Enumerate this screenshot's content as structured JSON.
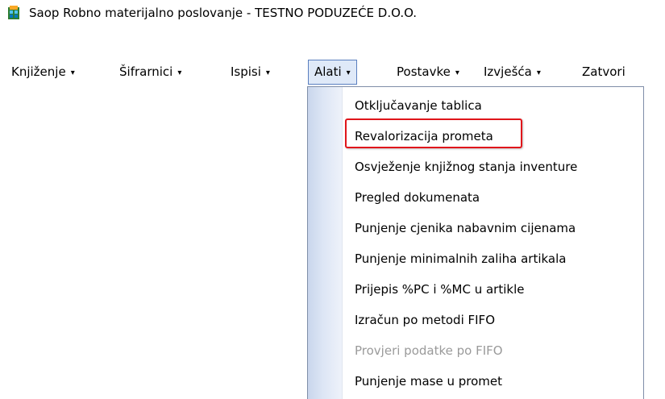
{
  "window": {
    "title": "Saop  Robno materijalno poslovanje - TESTNO PODUZEĆE D.O.O.",
    "icon": "saop-app-icon"
  },
  "menubar": {
    "items": [
      {
        "label": "Knjiženje",
        "accel": "K",
        "caret": "▾"
      },
      {
        "label": "Šifrarnici",
        "accel": "f",
        "caret": "▾"
      },
      {
        "label": "Ispisi",
        "accel": "I",
        "caret": "▾"
      },
      {
        "label": "Alati",
        "accel": "A",
        "caret": "▾",
        "active": true
      },
      {
        "label": "Postavke",
        "accel": "P",
        "caret": "▾"
      },
      {
        "label": "Izvješća",
        "accel": "",
        "caret": "▾"
      },
      {
        "label": "Zatvori",
        "accel": "Z"
      }
    ]
  },
  "alati_menu": {
    "items": [
      {
        "label": "Otključavanje tablica",
        "enabled": true
      },
      {
        "label": "Revalorizacija prometa",
        "enabled": true,
        "highlighted": true
      },
      {
        "label": "Osvježenje knjižnog stanja inventure",
        "enabled": true
      },
      {
        "label": "Pregled dokumenata",
        "enabled": true
      },
      {
        "label": "Punjenje cjenika nabavnim cijenama",
        "enabled": true
      },
      {
        "label": "Punjenje minimalnih zaliha artikala",
        "enabled": true
      },
      {
        "label": "Prijepis %PC i %MC u artikle",
        "enabled": true
      },
      {
        "label": "Izračun po metodi FIFO",
        "enabled": true
      },
      {
        "label": "Provjeri podatke po FIFO",
        "enabled": false
      },
      {
        "label": "Punjenje mase u promet",
        "enabled": true
      }
    ]
  },
  "colors": {
    "highlight_border": "#e0151b",
    "active_menu_bg": "#dfe9f8",
    "active_menu_border": "#5a7fbf",
    "disabled_text": "#9a9a9a"
  }
}
